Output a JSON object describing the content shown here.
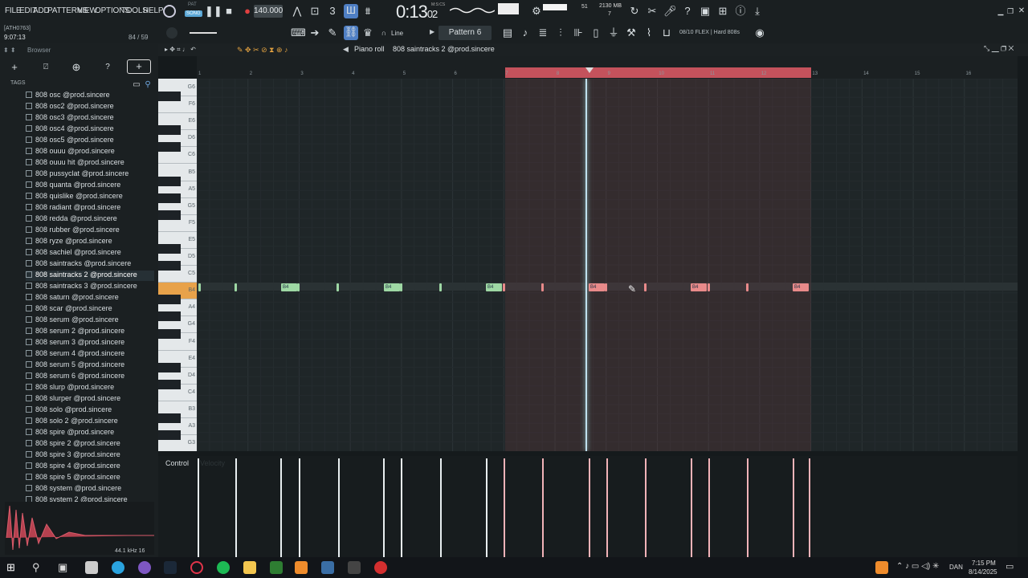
{
  "menu": [
    "FILE",
    "EDIT",
    "ADD",
    "PATTERNS",
    "VIEW",
    "OPTIONS",
    "TOOLS",
    "HELP"
  ],
  "transport": {
    "mode_top": "PAT",
    "mode_bottom": "SONG",
    "bpm": "140.000",
    "time_main": "0:13",
    "time_sub": "02",
    "time_label": "M:S:CS"
  },
  "status": {
    "cpu": "51",
    "mem": "2130 MB",
    "voices": "7"
  },
  "hint": {
    "line1": "[ATH0763]",
    "line2": "9:07:13",
    "ratio": "84 / 59"
  },
  "snap": "Line",
  "pattern": "Pattern 6",
  "plugin_info": "08/10  FLEX | Hard 808s",
  "browser": {
    "title": "Browser",
    "tags": "TAGS",
    "items": [
      "808 osc @prod.sincere",
      "808 osc2 @prod.sincere",
      "808 osc3 @prod.sincere",
      "808 osc4 @prod.sincere",
      "808 osc5 @prod.sincere",
      "808 ouuu @prod.sincere",
      "808 ouuu hit @prod.sincere",
      "808 pussyclat @prod.sincere",
      "808 quanta @prod.sincere",
      "808 quislike @prod.sincere",
      "808 radiant @prod.sincere",
      "808 redda @prod.sincere",
      "808 rubber @prod.sincere",
      "808 ryze @prod.sincere",
      "808 sachiel @prod.sincere",
      "808 saintracks @prod.sincere",
      "808 saintracks 2 @prod.sincere",
      "808 saintracks 3 @prod.sincere",
      "808 saturn @prod.sincere",
      "808 scar @prod.sincere",
      "808 serum @prod.sincere",
      "808 serum 2 @prod.sincere",
      "808 serum 3 @prod.sincere",
      "808 serum 4 @prod.sincere",
      "808 serum 5 @prod.sincere",
      "808 serum 6 @prod.sincere",
      "808 slurp @prod.sincere",
      "808 slurper @prod.sincere",
      "808 solo @prod.sincere",
      "808 solo 2 @prod.sincere",
      "808 spire @prod.sincere",
      "808 spire 2 @prod.sincere",
      "808 spire 3 @prod.sincere",
      "808 spire 4 @prod.sincere",
      "808 spire 5 @prod.sincere",
      "808 system @prod.sincere",
      "808 system 2 @prod.sincere"
    ],
    "selected_index": 16,
    "sample_info": "44.1 kHz 16"
  },
  "piano_roll": {
    "title": "Piano roll",
    "channel": "808 saintracks 2 @prod.sincere",
    "ruler": [
      "1",
      "2",
      "3",
      "4",
      "5",
      "6",
      "7",
      "8",
      "9",
      "10",
      "11",
      "12",
      "13",
      "14",
      "15",
      "16"
    ],
    "keys": [
      "G6",
      "F6",
      "E6",
      "D6",
      "C6",
      "B5",
      "A5",
      "G5",
      "F5",
      "E5",
      "D5",
      "C5",
      "B4",
      "A4",
      "G4",
      "F4",
      "E4",
      "D4",
      "C4",
      "B3",
      "A3",
      "G3"
    ],
    "note_label": "B4",
    "control_label": "Control",
    "control_value": "Velocity"
  },
  "clock": {
    "time": "7:15 PM",
    "date": "8/14/2025",
    "lang": "DAN"
  },
  "colors": {
    "note_green": "#9ed8a4",
    "note_red": "#e88a8a",
    "accent_green": "#6fbf73",
    "loop": "#c4525c"
  }
}
